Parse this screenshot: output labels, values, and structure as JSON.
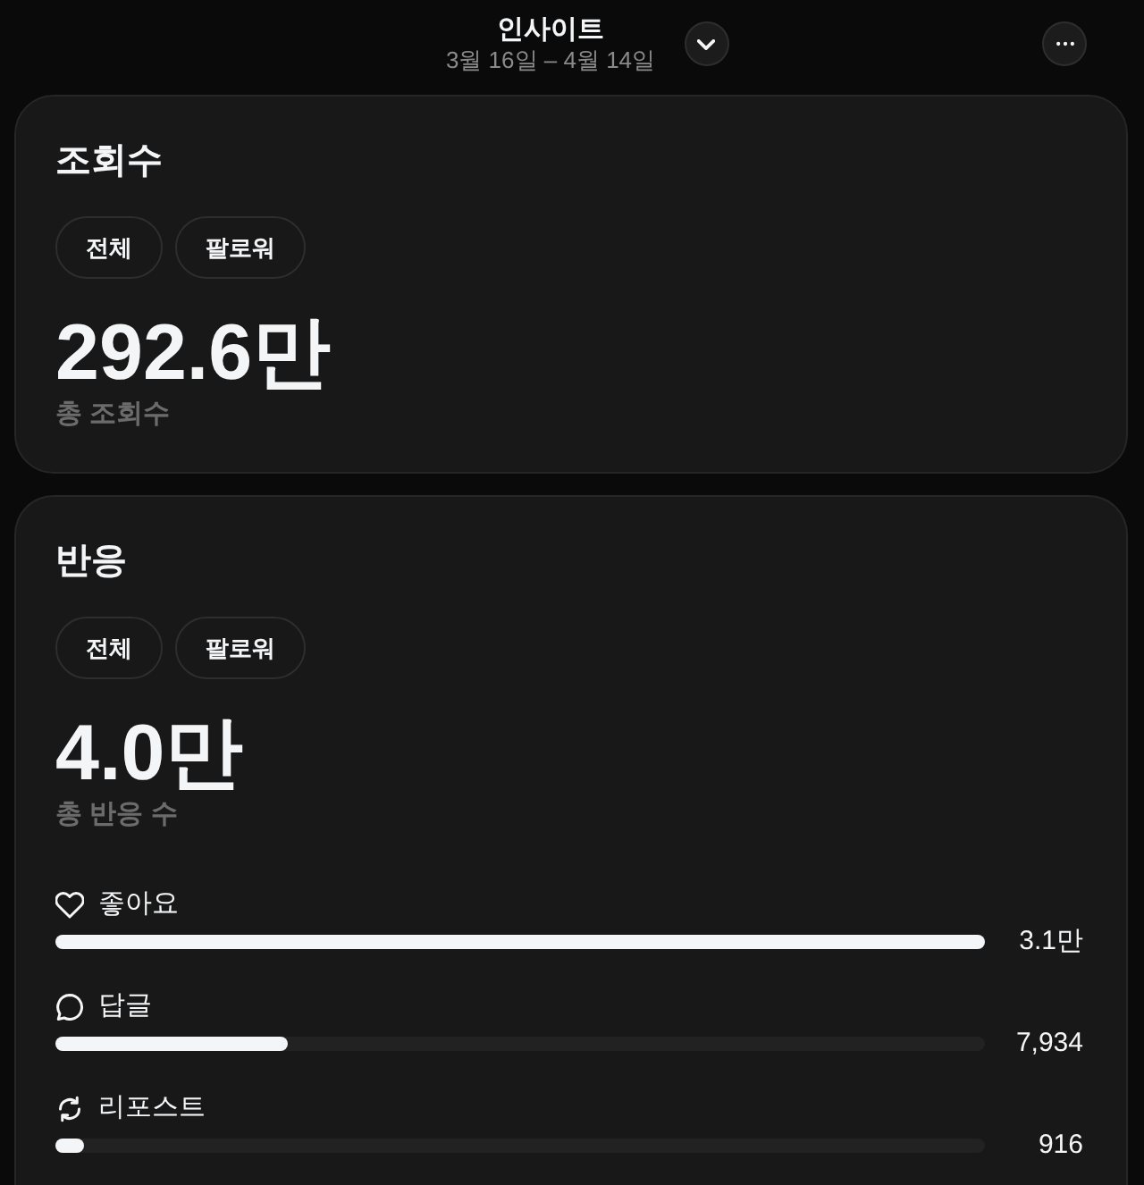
{
  "header": {
    "title": "인사이트",
    "date_range": "3월 16일 – 4월 14일"
  },
  "cards": [
    {
      "title": "조회수",
      "filters": [
        {
          "label": "전체"
        },
        {
          "label": "팔로워"
        }
      ],
      "total": "292.6만",
      "total_label": "총 조회수"
    },
    {
      "title": "반응",
      "filters": [
        {
          "label": "전체"
        },
        {
          "label": "팔로워"
        }
      ],
      "total": "4.0만",
      "total_label": "총 반응 수",
      "metrics": [
        {
          "kind": "like",
          "label": "좋아요",
          "level": 1.0,
          "value": "3.1만"
        },
        {
          "kind": "reply",
          "label": "답글",
          "level": 0.25,
          "value": "7,934"
        },
        {
          "kind": "repost",
          "label": "리포스트",
          "level": 0.03,
          "value": "916"
        }
      ]
    }
  ]
}
